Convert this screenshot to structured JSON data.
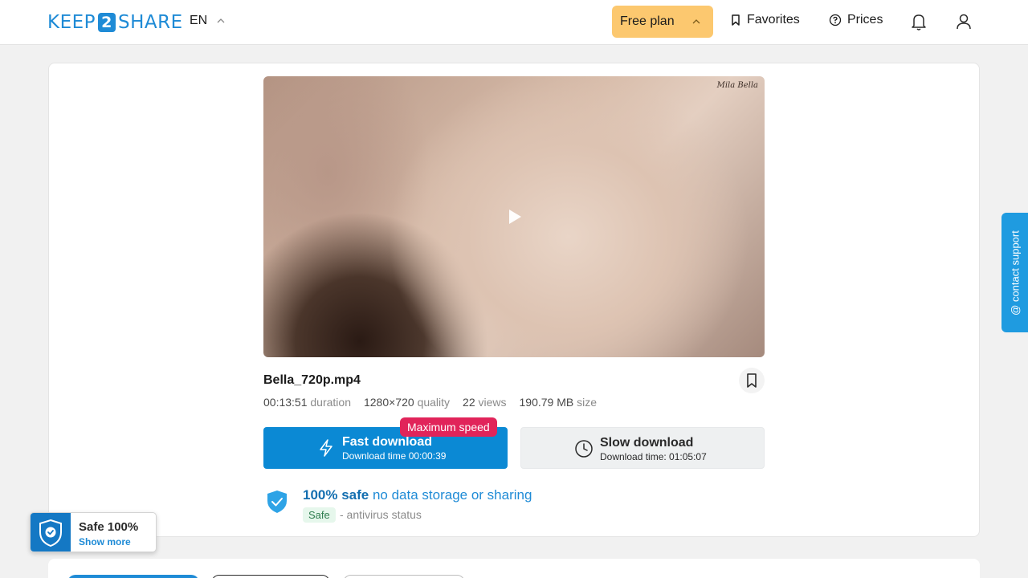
{
  "header": {
    "logo_left": "KEEP",
    "logo_mid": "2",
    "logo_right": "SHARE",
    "language": "EN",
    "plan_label": "Free plan",
    "favorites_label": "Favorites",
    "prices_label": "Prices"
  },
  "video": {
    "watermark": "Mila Bella"
  },
  "file": {
    "name": "Bella_720p.mp4",
    "duration": "00:13:51",
    "duration_label": "duration",
    "quality": "1280×720",
    "quality_label": "quality",
    "views": "22",
    "views_label": "views",
    "size": "190.79 MB",
    "size_label": "size"
  },
  "download": {
    "fast_title": "Fast download",
    "fast_sub": "Download time 00:00:39",
    "max_speed_badge": "Maximum speed",
    "slow_title": "Slow download",
    "slow_sub": "Download time: 01:05:07"
  },
  "safety": {
    "headline_strong": "100% safe",
    "headline_rest": "no data storage or sharing",
    "badge": "Safe",
    "status_text": "- antivirus status"
  },
  "contact_tab": "@ contact support",
  "safe_widget": {
    "title": "Safe 100%",
    "more": "Show more"
  },
  "colors": {
    "accent": "#0b89d4",
    "plan_bg": "#fcc86f",
    "badge_red": "#e1245a"
  }
}
